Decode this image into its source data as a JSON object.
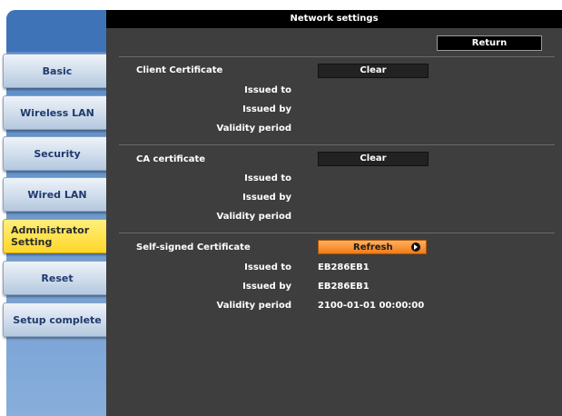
{
  "window": {
    "title": "Network settings"
  },
  "toolbar": {
    "return_label": "Return"
  },
  "sidebar": {
    "items": [
      {
        "label": "Basic"
      },
      {
        "label": "Wireless LAN"
      },
      {
        "label": "Security"
      },
      {
        "label": "Wired LAN"
      },
      {
        "label": "Administrator Setting",
        "active": true
      },
      {
        "label": "Reset"
      },
      {
        "label": "Setup complete"
      }
    ]
  },
  "sections": {
    "client": {
      "title": "Client Certificate",
      "button": "Clear",
      "issued_to_label": "Issued to",
      "issued_by_label": "Issued by",
      "validity_label": "Validity period",
      "issued_to": "",
      "issued_by": "",
      "validity": ""
    },
    "ca": {
      "title": "CA certificate",
      "button": "Clear",
      "issued_to_label": "Issued to",
      "issued_by_label": "Issued by",
      "validity_label": "Validity period",
      "issued_to": "",
      "issued_by": "",
      "validity": ""
    },
    "self_signed": {
      "title": "Self-signed Certificate",
      "button": "Refresh",
      "button_icon": "arrow-right-circle-icon",
      "issued_to_label": "Issued to",
      "issued_by_label": "Issued by",
      "validity_label": "Validity period",
      "issued_to": "EB286EB1",
      "issued_by": "EB286EB1",
      "validity": "2100-01-01 00:00:00"
    }
  },
  "colors": {
    "active_tab": "#ffd72a",
    "refresh_button": "#f27b16",
    "panel_bg": "#3e3e3e",
    "sidebar_bg": "#6e9bd0"
  }
}
